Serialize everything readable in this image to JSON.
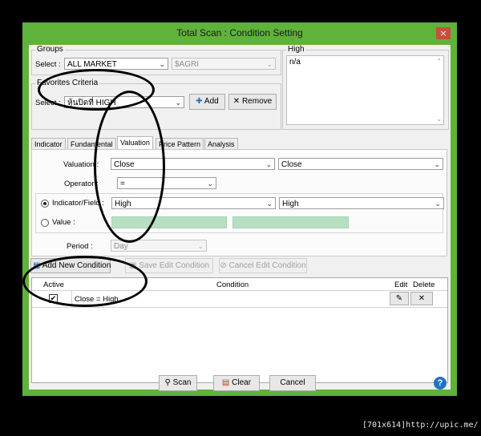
{
  "window": {
    "title": "Total Scan : Condition Setting",
    "close_glyph": "×"
  },
  "groups": {
    "legend": "Groups",
    "select_label": "Select :",
    "market": "ALL MARKET",
    "sector": "$AGRI"
  },
  "high_box": {
    "legend": "High",
    "text": "n/a"
  },
  "favorites": {
    "legend": "Favorites Criteria",
    "select_label": "Select :",
    "value": "หุ้นปิดที่ HIGH",
    "add_label": "Add",
    "remove_label": "Remove"
  },
  "tabs": [
    "Indicator",
    "Fundamental",
    "Valuation",
    "Price Pattern",
    "Analysis"
  ],
  "active_tab": "Valuation",
  "valuation": {
    "valuation_label": "Valuation :",
    "valuation_left": "Close",
    "valuation_right": "Close",
    "operator_label": "Operator :",
    "operator_value": "=",
    "indicator_label": "Indicator/Field :",
    "indicator_left": "High",
    "indicator_right": "High",
    "value_label": "Value :",
    "period_label": "Period :",
    "period_value": "Day"
  },
  "condition_buttons": {
    "add_new": "Add New Condition",
    "save_edit": "Save Edit Condition",
    "cancel_edit": "Cancel Edit Condition"
  },
  "table": {
    "headers": {
      "active": "Active",
      "condition": "Condition",
      "edit": "Edit",
      "delete": "Delete"
    },
    "rows": [
      {
        "active": true,
        "condition": "Close = High"
      }
    ]
  },
  "footer": {
    "scan": "Scan",
    "clear": "Clear",
    "cancel": "Cancel",
    "help": "?"
  },
  "watermark": "[701x614]http://upic.me/",
  "colors": {
    "window_frame": "#5fb23a",
    "client_bg": "#f0f0f0",
    "close_button": "#c94f3d",
    "disabled_value": "#b7dfc2",
    "help_icon": "#1e73c8"
  }
}
